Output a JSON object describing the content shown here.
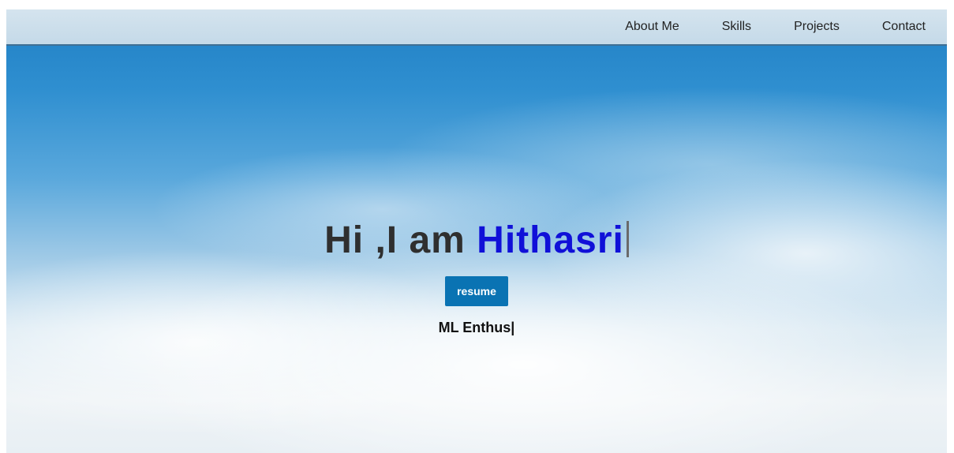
{
  "nav": {
    "items": [
      {
        "label": "About Me"
      },
      {
        "label": "Skills"
      },
      {
        "label": "Projects"
      },
      {
        "label": "Contact"
      }
    ]
  },
  "hero": {
    "greeting_prefix": "Hi ,I am ",
    "name": "Hithasri",
    "resume_label": "resume",
    "typed_text": "ML Enthus|"
  },
  "colors": {
    "name_accent": "#1010d8",
    "button_bg": "#0a73b3",
    "nav_border": "#3f6f94"
  }
}
